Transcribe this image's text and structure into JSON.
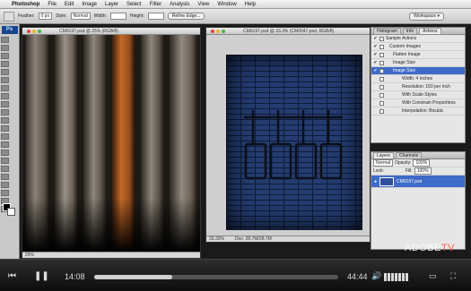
{
  "menubar": {
    "apple": "",
    "app": "Photoshop",
    "items": [
      "File",
      "Edit",
      "Image",
      "Layer",
      "Select",
      "Filter",
      "Analysis",
      "View",
      "Window",
      "Help"
    ]
  },
  "options": {
    "feather_label": "Feather:",
    "feather_value": "0 px",
    "style_label": "Style:",
    "style_value": "Normal",
    "width_label": "Width:",
    "height_label": "Height:",
    "refine_button": "Refine Edge...",
    "workspace_button": "Workspace ▾"
  },
  "toolpanel": {
    "logo": "Ps"
  },
  "doc_left": {
    "title": "CM0197.psd @ 25% (RGB/8)",
    "status": "25%"
  },
  "doc_right": {
    "title": "CM0197.psd @ 33.3% (CM0047.psd, RGB/8)",
    "status": "33.33%",
    "status_doc": "Doc: 28.7M/28.7M"
  },
  "history_panel": {
    "tabs": [
      "Histogram",
      "Info",
      "Actions"
    ],
    "rows": [
      {
        "check": "✔",
        "label": "Sample Actions",
        "selected": false
      },
      {
        "check": "✔",
        "label": "Custom Images",
        "selected": false
      },
      {
        "check": "✔",
        "label": "Flatten Image",
        "selected": false
      },
      {
        "check": "✔",
        "label": "Image Size",
        "selected": false
      },
      {
        "check": "✔",
        "label": "Image Size",
        "selected": true
      },
      {
        "check": "",
        "label": "Width: 4 inches",
        "selected": false
      },
      {
        "check": "",
        "label": "Resolution: 150 per inch",
        "selected": false
      },
      {
        "check": "",
        "label": "With Scale Styles",
        "selected": false
      },
      {
        "check": "",
        "label": "With Constrain Proportions",
        "selected": false
      },
      {
        "check": "",
        "label": "Interpolation: Bicubic",
        "selected": false
      }
    ]
  },
  "layers_panel": {
    "tabs": [
      "Layers",
      "Channels"
    ],
    "blend_mode": "Normal",
    "opacity_label": "Opacity:",
    "opacity_value": "100%",
    "lock_label": "Lock:",
    "fill_label": "Fill:",
    "fill_value": "100%",
    "layer_name": "CM0197.psd"
  },
  "player": {
    "current_time": "14:08",
    "total_time": "44:44",
    "progress": 0.32,
    "brand": "ADOBE",
    "brand_suffix": "TV"
  }
}
